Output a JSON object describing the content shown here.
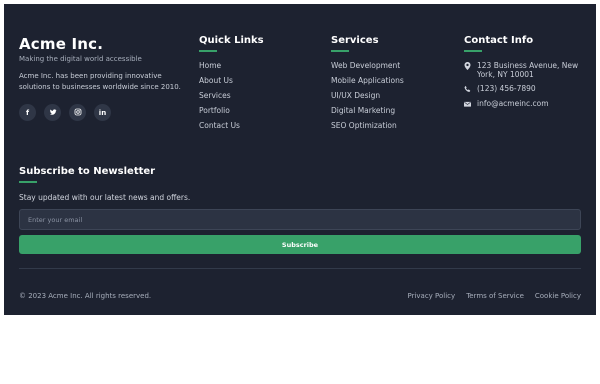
{
  "brand": {
    "name": "Acme Inc.",
    "tagline": "Making the digital world accessible",
    "about": "Acme Inc. has been providing innovative solutions to businesses worldwide since 2010."
  },
  "socials": [
    {
      "icon": "facebook-icon",
      "glyph": "f"
    },
    {
      "icon": "twitter-icon"
    },
    {
      "icon": "instagram-icon"
    },
    {
      "icon": "linkedin-icon",
      "glyph": "in"
    }
  ],
  "quick_links": {
    "title": "Quick Links",
    "items": [
      "Home",
      "About Us",
      "Services",
      "Portfolio",
      "Contact Us"
    ]
  },
  "services": {
    "title": "Services",
    "items": [
      "Web Development",
      "Mobile Applications",
      "UI/UX Design",
      "Digital Marketing",
      "SEO Optimization"
    ]
  },
  "contact": {
    "title": "Contact Info",
    "address": "123 Business Avenue, New York, NY 10001",
    "phone": "(123) 456-7890",
    "email": "info@acmeinc.com"
  },
  "newsletter": {
    "title": "Subscribe to Newsletter",
    "text": "Stay updated with our latest news and offers.",
    "placeholder": "Enter your email",
    "button": "Subscribe"
  },
  "bottom": {
    "copyright": "© 2023 Acme Inc. All rights reserved.",
    "links": [
      "Privacy Policy",
      "Terms of Service",
      "Cookie Policy"
    ]
  },
  "colors": {
    "background": "#1d2230",
    "accent": "#38a169",
    "input_background": "#2c3343"
  }
}
